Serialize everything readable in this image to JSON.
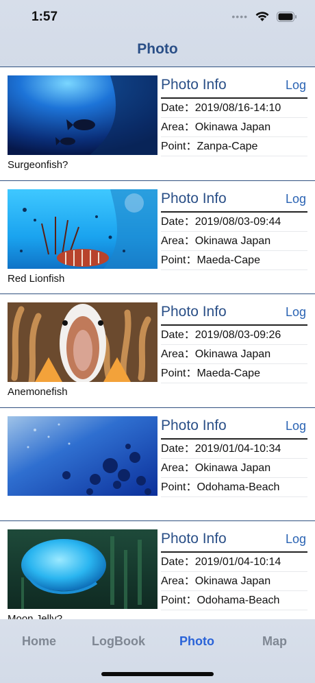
{
  "status": {
    "time": "1:57"
  },
  "nav": {
    "title": "Photo"
  },
  "cards": [
    {
      "caption": "Surgeonfish?",
      "info_title": "Photo Info",
      "log_label": "Log",
      "date": "Date：2019/08/16-14:10",
      "area": "Area：Okinawa Japan",
      "point": "Point：Zanpa-Cape"
    },
    {
      "caption": "Red Lionfish",
      "info_title": "Photo Info",
      "log_label": "Log",
      "date": "Date：2019/08/03-09:44",
      "area": "Area：Okinawa Japan",
      "point": "Point：Maeda-Cape"
    },
    {
      "caption": "Anemonefish",
      "info_title": "Photo Info",
      "log_label": "Log",
      "date": "Date：2019/08/03-09:26",
      "area": "Area：Okinawa Japan",
      "point": "Point：Maeda-Cape"
    },
    {
      "caption": "",
      "info_title": "Photo Info",
      "log_label": "Log",
      "date": "Date：2019/01/04-10:34",
      "area": "Area：Okinawa Japan",
      "point": "Point：Odohama-Beach"
    },
    {
      "caption": "Moon Jelly?",
      "info_title": "Photo Info",
      "log_label": "Log",
      "date": "Date：2019/01/04-10:14",
      "area": "Area：Okinawa Japan",
      "point": "Point：Odohama-Beach"
    }
  ],
  "tabs": [
    {
      "label": "Home"
    },
    {
      "label": "LogBook"
    },
    {
      "label": "Photo"
    },
    {
      "label": "Map"
    }
  ],
  "colors": {
    "accent": "#2a63d8",
    "title": "#2a4f87",
    "inactive_tab": "#7f8793"
  }
}
